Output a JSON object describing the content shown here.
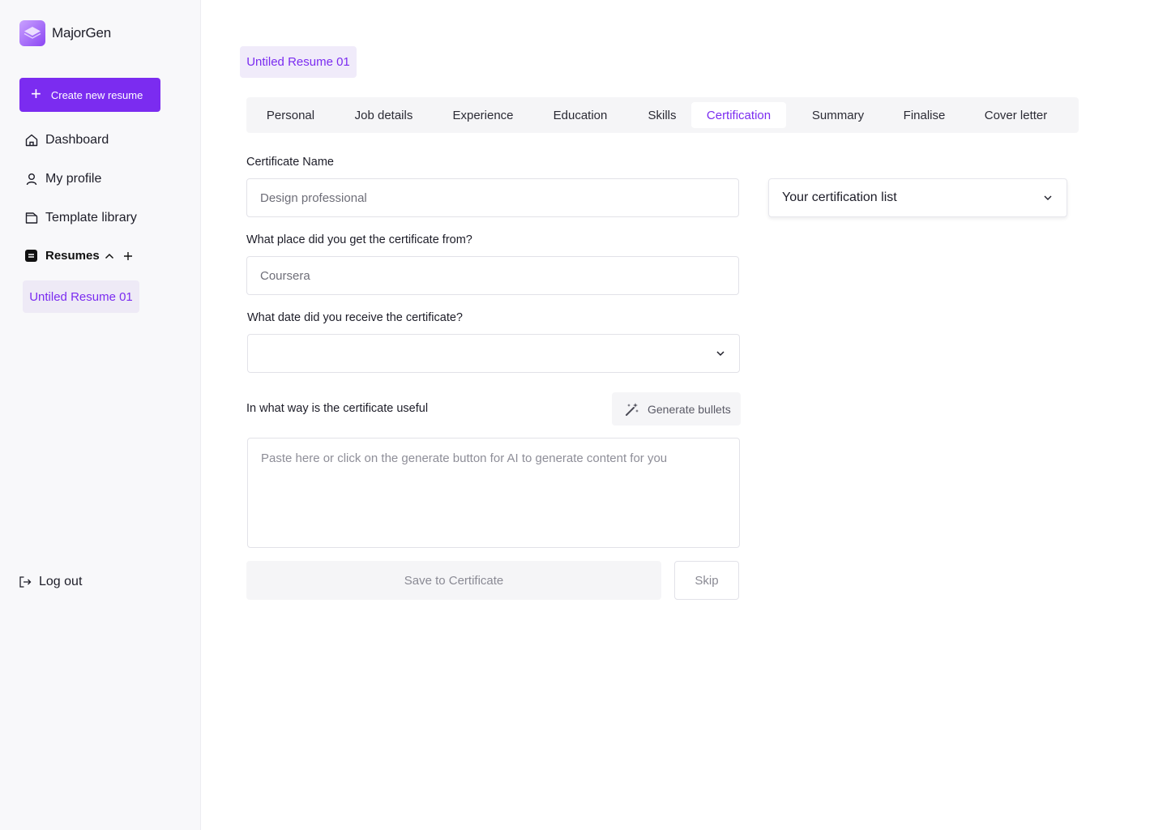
{
  "app": {
    "name": "MajorGen",
    "accent_color": "#7b2cf0"
  },
  "sidebar": {
    "create_button": "Create new resume",
    "items": [
      {
        "label": "Dashboard",
        "icon": "home-icon"
      },
      {
        "label": "My profile",
        "icon": "user-icon"
      },
      {
        "label": "Template library",
        "icon": "folder-icon"
      }
    ],
    "resumes": {
      "label": "Resumes",
      "items": [
        {
          "label": "Untiled Resume 01"
        }
      ]
    },
    "logout": "Log out"
  },
  "main": {
    "document_title": "Untiled Resume 01",
    "tabs": [
      {
        "label": "Personal",
        "active": false
      },
      {
        "label": "Job details",
        "active": false
      },
      {
        "label": "Experience",
        "active": false
      },
      {
        "label": "Education",
        "active": false
      },
      {
        "label": "Skills",
        "active": false
      },
      {
        "label": "Certification",
        "active": true
      },
      {
        "label": "Summary",
        "active": false
      },
      {
        "label": "Finalise",
        "active": false
      },
      {
        "label": "Cover letter",
        "active": false
      }
    ],
    "form": {
      "certificate_name": {
        "label": "Certificate Name",
        "placeholder": "Design professional",
        "value": ""
      },
      "place": {
        "label": "What place did you get the certificate from?",
        "placeholder": "Coursera",
        "value": ""
      },
      "date": {
        "label": "What date did you receive the certificate?",
        "value": ""
      },
      "usefulness": {
        "label": "In what way is the certificate useful",
        "placeholder": "Paste here or click on the generate button for AI to generate content for you",
        "value": ""
      },
      "generate_button": "Generate bullets",
      "save_button": "Save to Certificate",
      "skip_button": "Skip"
    },
    "certification_list": {
      "label": "Your certification list"
    }
  }
}
